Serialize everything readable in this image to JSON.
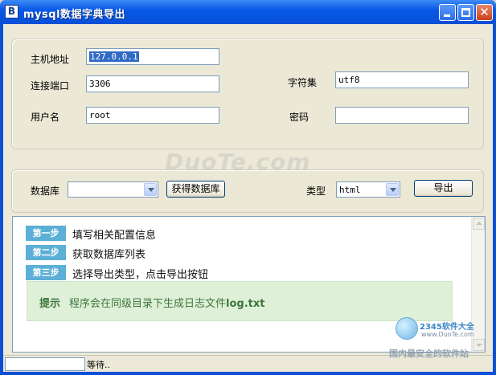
{
  "window": {
    "title": "mysql数据字典导出",
    "icon_letter": "B"
  },
  "connection": {
    "host_label": "主机地址",
    "host_value": "127.0.0.1",
    "port_label": "连接端口",
    "port_value": "3306",
    "charset_label": "字符集",
    "charset_value": "utf8",
    "user_label": "用户名",
    "user_value": "root",
    "password_label": "密码",
    "password_value": ""
  },
  "export": {
    "database_label": "数据库",
    "database_value": "",
    "fetch_button": "获得数据库",
    "type_label": "类型",
    "type_value": "html",
    "export_button": "导出"
  },
  "instructions": {
    "steps": [
      {
        "badge": "第一步",
        "text": "填写相关配置信息"
      },
      {
        "badge": "第二步",
        "text": "获取数据库列表"
      },
      {
        "badge": "第三步",
        "text": "选择导出类型，点击导出按钮"
      }
    ],
    "tip_title": "提示",
    "tip_text": "程序会在同级目录下生成日志文件",
    "tip_file": "log.txt"
  },
  "status": {
    "progress": 0,
    "text": "等待.."
  },
  "watermark": {
    "site": "DuoTe.com",
    "logo_top": "2345软件大全",
    "logo_url": "www.DuoTe.com",
    "logo_bottom": "国内最安全的软件站"
  },
  "colors": {
    "titlebar": "#0a5ae8",
    "step_badge": "#5cafd6",
    "tip_bg": "#dff0d8",
    "tip_text": "#3c763d"
  }
}
